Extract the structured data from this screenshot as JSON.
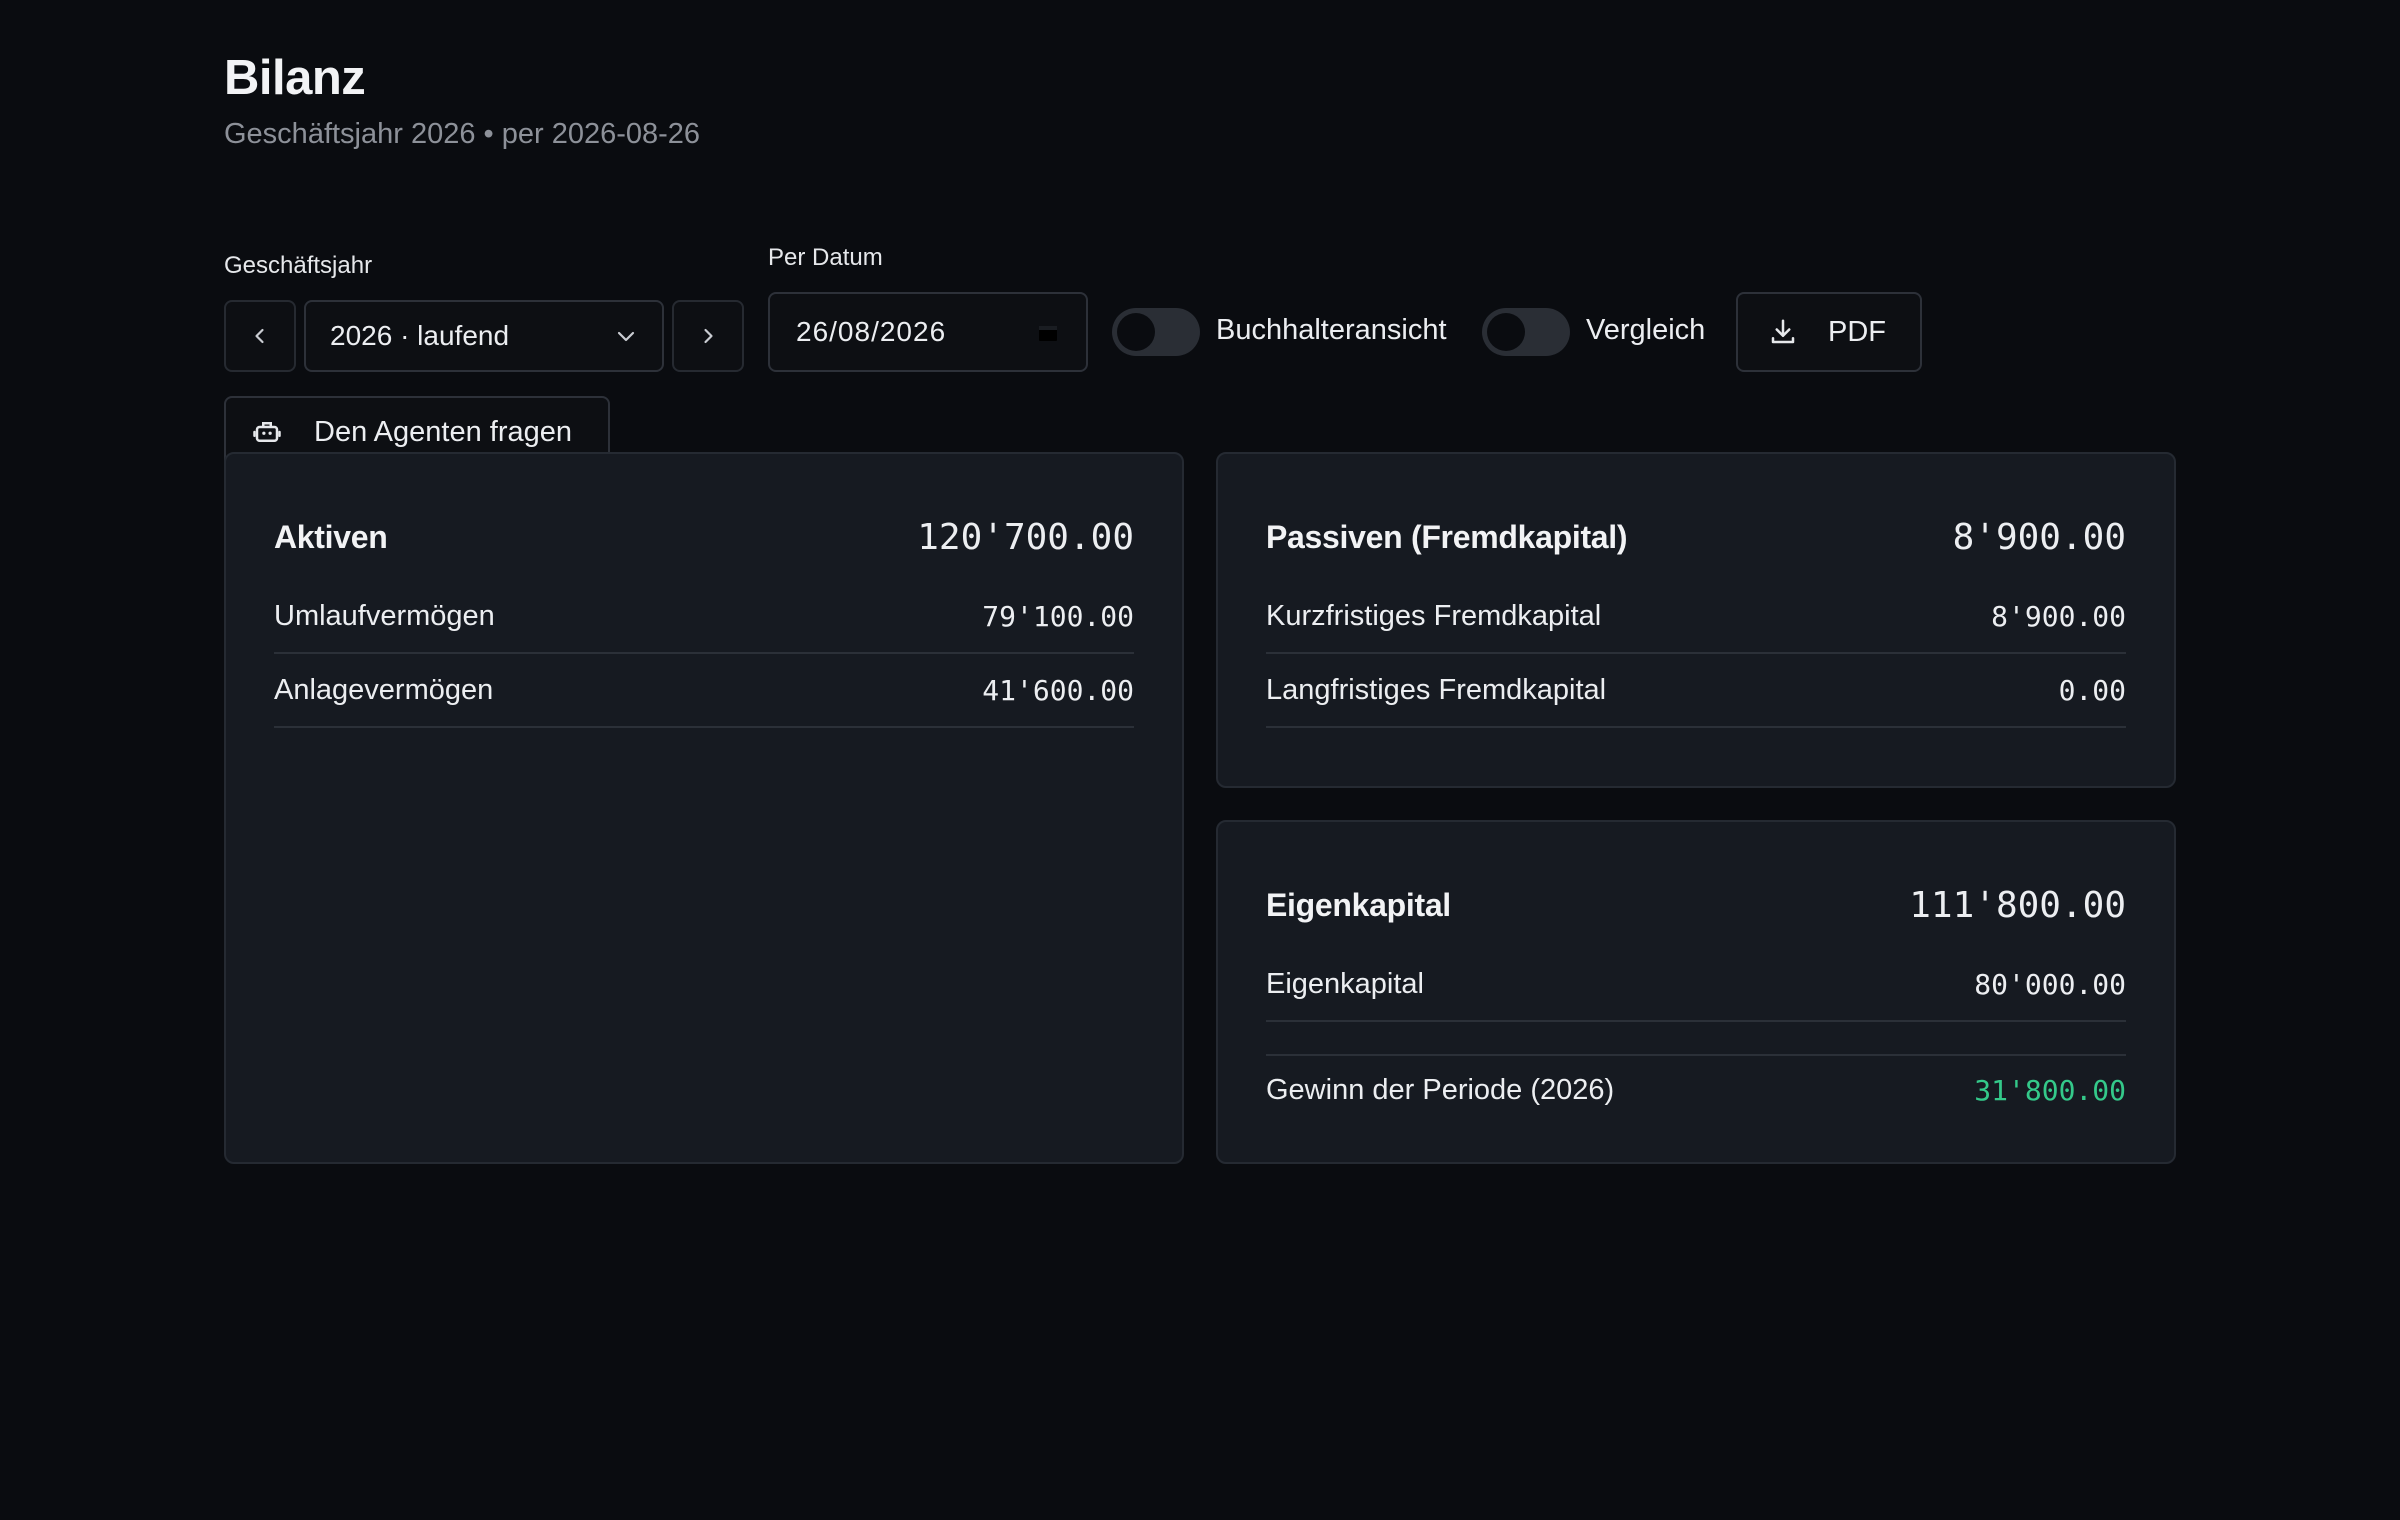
{
  "header": {
    "title": "Bilanz",
    "subtitle": "Geschäftsjahr 2026 • per 2026-08-26"
  },
  "controls": {
    "fiscal_year_label": "Geschäftsjahr",
    "fiscal_year_value": "2026 · laufend",
    "date_label": "Per Datum",
    "date_value": "26/08/2026",
    "toggle_accountant_label": "Buchhalteransicht",
    "toggle_accountant_on": false,
    "toggle_compare_label": "Vergleich",
    "toggle_compare_on": false,
    "pdf_label": "PDF",
    "agent_label": "Den Agenten fragen"
  },
  "cards": {
    "aktiven": {
      "title": "Aktiven",
      "total": "120'700.00",
      "rows": [
        {
          "label": "Umlaufvermögen",
          "amount": "79'100.00"
        },
        {
          "label": "Anlagevermögen",
          "amount": "41'600.00"
        }
      ]
    },
    "passiven": {
      "title": "Passiven (Fremdkapital)",
      "total": "8'900.00",
      "rows": [
        {
          "label": "Kurzfristiges Fremdkapital",
          "amount": "8'900.00"
        },
        {
          "label": "Langfristiges Fremdkapital",
          "amount": "0.00"
        }
      ]
    },
    "eigenkapital": {
      "title": "Eigenkapital",
      "total": "111'800.00",
      "rows": [
        {
          "label": "Eigenkapital",
          "amount": "80'000.00"
        }
      ],
      "profit": {
        "label": "Gewinn der Periode (2026)",
        "amount": "31'800.00"
      }
    }
  },
  "colors": {
    "background": "#0a0c10",
    "card": "#161a21",
    "profit_positive": "#34c98a"
  }
}
